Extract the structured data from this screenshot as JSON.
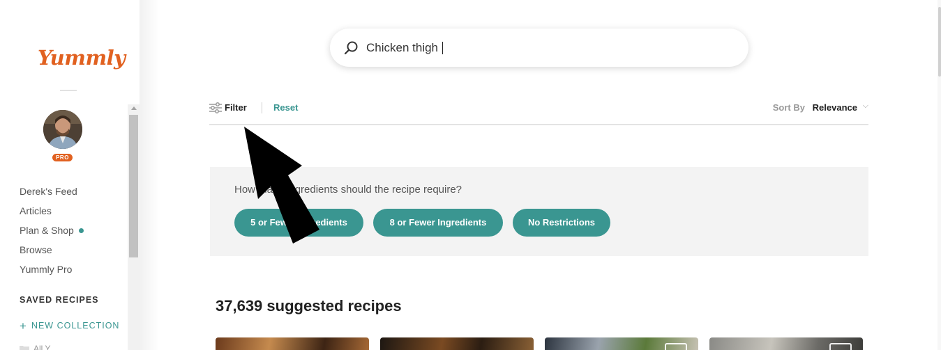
{
  "sidebar": {
    "logo": "Yummly",
    "pro_badge": "PRO",
    "nav": [
      "Derek's Feed",
      "Articles",
      "Plan & Shop",
      "Browse",
      "Yummly Pro"
    ],
    "saved_recipes_title": "SAVED RECIPES",
    "new_collection": "NEW COLLECTION",
    "all_yums": "All Y..."
  },
  "search": {
    "value": "Chicken thigh",
    "icon": "search-icon"
  },
  "filter_bar": {
    "filter_label": "Filter",
    "reset_label": "Reset",
    "sort_by_label": "Sort By",
    "sort_value": "Relevance",
    "sort_chevron": "⌵"
  },
  "ingredients_panel": {
    "question": "How many ingredients should the recipe require?",
    "chips": [
      "5 or Fewer Ingredients",
      "8 or Fewer Ingredients",
      "No Restrictions"
    ]
  },
  "results": {
    "count_text": "37,639 suggested recipes"
  },
  "colors": {
    "brand_orange": "#e16120",
    "accent_teal": "#3a9691"
  }
}
